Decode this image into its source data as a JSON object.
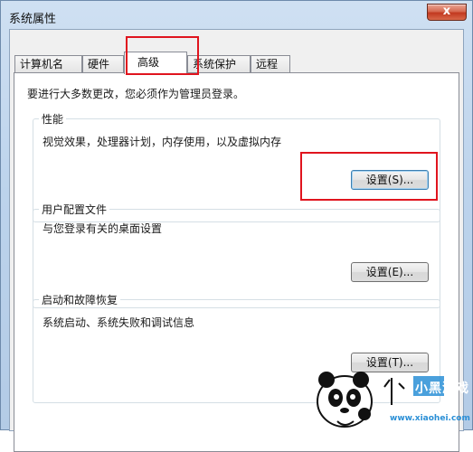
{
  "window": {
    "title": "系统属性",
    "close_label": "x"
  },
  "tabs": [
    {
      "label": "计算机名",
      "active": false
    },
    {
      "label": "硬件",
      "active": false
    },
    {
      "label": "高级",
      "active": true
    },
    {
      "label": "系统保护",
      "active": false
    },
    {
      "label": "远程",
      "active": false
    }
  ],
  "advanced": {
    "admin_note": "要进行大多数更改，您必须作为管理员登录。",
    "performance": {
      "label": "性能",
      "description": "视觉效果，处理器计划，内存使用，以及虚拟内存",
      "button": "设置(S)..."
    },
    "user_profiles": {
      "label": "用户配置文件",
      "description": "与您登录有关的桌面设置",
      "button": "设置(E)..."
    },
    "startup_recovery": {
      "label": "启动和故障恢复",
      "description": "系统启动、系统失败和调试信息",
      "button": "设置(T)..."
    }
  },
  "watermark": {
    "brand": "小黑游戏",
    "url": "www.xiaohei.com"
  },
  "colors": {
    "highlight": "#e0141e",
    "close_button": "#c2391f"
  }
}
